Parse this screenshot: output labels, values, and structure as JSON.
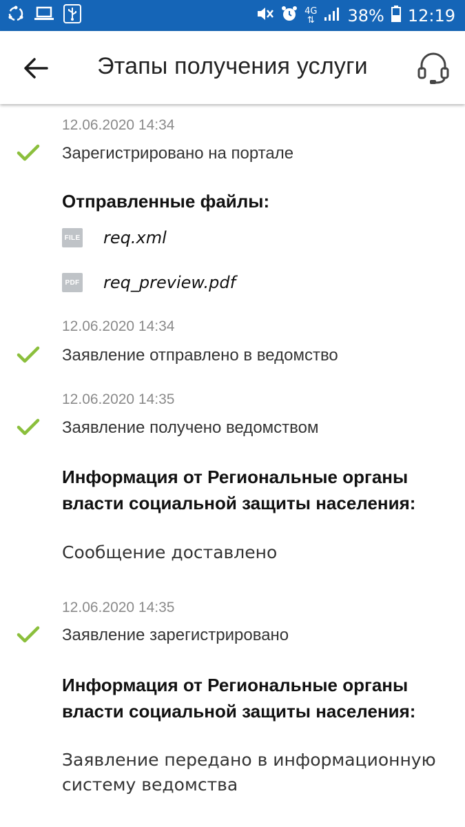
{
  "status_bar": {
    "network": "4G",
    "battery": "38%",
    "time": "12:19"
  },
  "header": {
    "title": "Этапы получения услуги",
    "back_icon": "arrow-left-icon",
    "support_icon": "headset-icon"
  },
  "stages": [
    {
      "date": "12.06.2020 14:34",
      "status": "Зарегистрировано на портале",
      "files_heading": "Отправленные файлы:",
      "files": [
        {
          "type": "FILE",
          "name": "req.xml"
        },
        {
          "type": "PDF",
          "name": "req_preview.pdf"
        }
      ]
    },
    {
      "date": "12.06.2020 14:34",
      "status": "Заявление отправлено в ведомство"
    },
    {
      "date": "12.06.2020 14:35",
      "status": "Заявление получено ведомством",
      "info_heading_line1": "Информация от Региональные органы",
      "info_heading_line2": "власти социальной защиты населения:",
      "message": "Сообщение доставлено"
    },
    {
      "date": "12.06.2020 14:35",
      "status": "Заявление зарегистрировано",
      "info_heading_line1": "Информация от Региональные органы",
      "info_heading_line2": "власти социальной защиты населения:",
      "message_line1": "Заявление передано в информационную",
      "message_line2": "систему ведомства"
    }
  ],
  "colors": {
    "status_bar": "#1565b7",
    "check": "#8bbf3c",
    "date_text": "#8a8a8a",
    "file_icon": "#bfc3c7"
  }
}
